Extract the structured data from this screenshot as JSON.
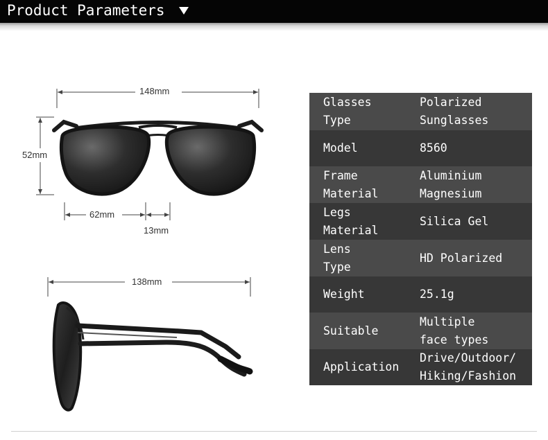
{
  "header": {
    "title": "Product Parameters",
    "arrow_icon": "triangle-down-icon"
  },
  "dimensions": {
    "front_width": "148mm",
    "front_height": "52mm",
    "lens_width": "62mm",
    "bridge_width": "13mm",
    "side_length": "138mm"
  },
  "params": [
    {
      "label": "Glasses\nType",
      "value": "Polarized\nSunglasses"
    },
    {
      "label": "Model",
      "value": "8560"
    },
    {
      "label": "Frame\nMaterial",
      "value": "Aluminium\nMagnesium"
    },
    {
      "label": "Legs\nMaterial",
      "value": "Silica Gel"
    },
    {
      "label": "Lens\nType",
      "value": "HD Polarized"
    },
    {
      "label": "Weight",
      "value": "25.1g"
    },
    {
      "label": "Suitable",
      "value": "Multiple\nface types"
    },
    {
      "label": "Application",
      "value": "Drive/Outdoor/\nHiking/Fashion"
    }
  ]
}
